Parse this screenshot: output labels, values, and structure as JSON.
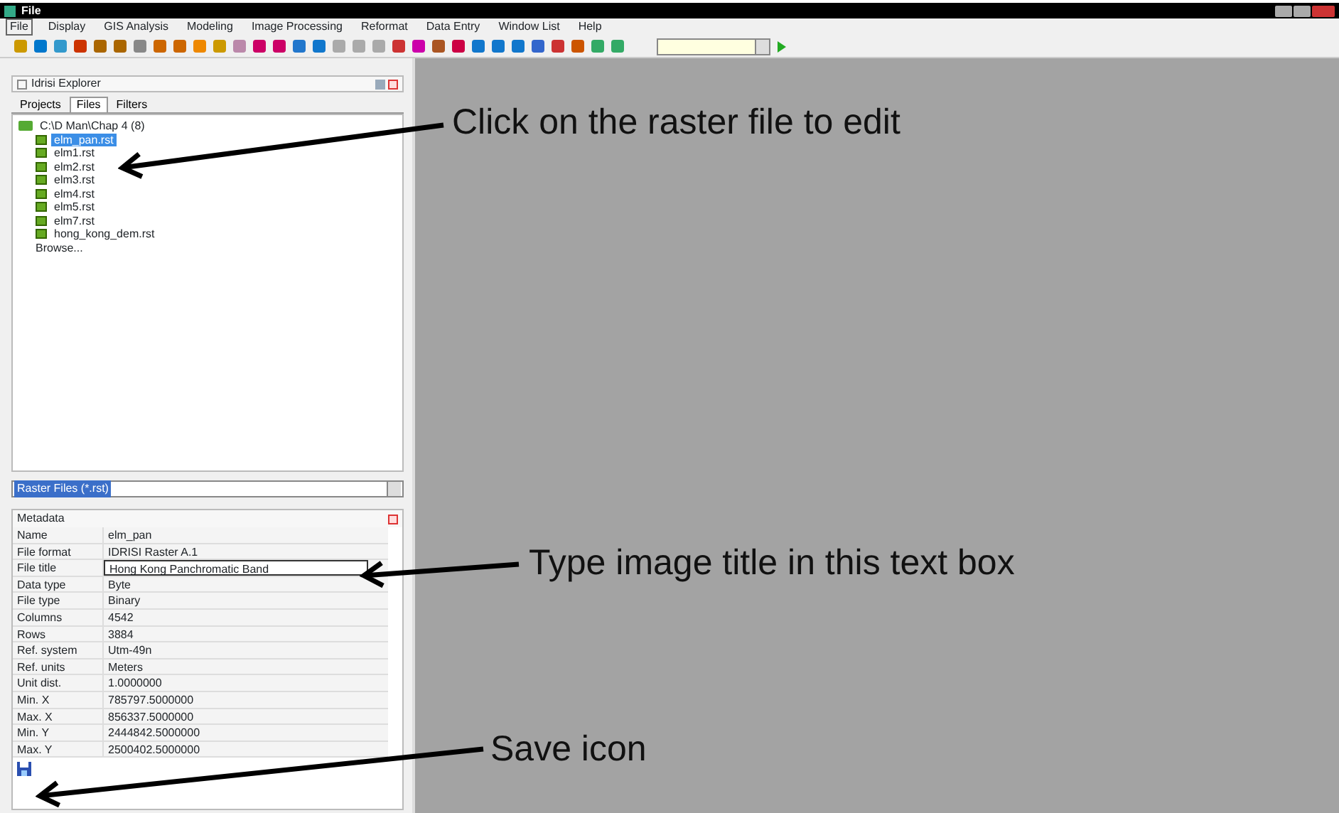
{
  "window": {
    "title": "File"
  },
  "menu": [
    {
      "label": "File",
      "selected": true
    },
    {
      "label": "Display",
      "selected": false
    },
    {
      "label": "GIS Analysis",
      "selected": false
    },
    {
      "label": "Modeling",
      "selected": false
    },
    {
      "label": "Image Processing",
      "selected": false
    },
    {
      "label": "Reformat",
      "selected": false
    },
    {
      "label": "Data Entry",
      "selected": false
    },
    {
      "label": "Window List",
      "selected": false
    },
    {
      "label": "Help",
      "selected": false
    }
  ],
  "explorer": {
    "title": "Idrisi Explorer",
    "tabs": [
      {
        "label": "Projects",
        "selected": false
      },
      {
        "label": "Files",
        "selected": true
      },
      {
        "label": "Filters",
        "selected": false
      }
    ],
    "tree": {
      "label": "C:\\D Man\\Chap 4 (8)",
      "children": [
        {
          "label": "elm_pan.rst",
          "selected": true
        },
        {
          "label": "elm1.rst",
          "selected": false
        },
        {
          "label": "elm2.rst",
          "selected": false
        },
        {
          "label": "elm3.rst",
          "selected": false
        },
        {
          "label": "elm4.rst",
          "selected": false
        },
        {
          "label": "elm5.rst",
          "selected": false
        },
        {
          "label": "elm7.rst",
          "selected": false
        },
        {
          "label": "hong_kong_dem.rst",
          "selected": false
        }
      ]
    },
    "browse": "Browse...",
    "filter": "Raster Files (*.rst)"
  },
  "metadata": {
    "title": "Metadata",
    "rows": [
      {
        "label": "Name",
        "value": "elm_pan",
        "editing": false
      },
      {
        "label": "File format",
        "value": "IDRISI Raster A.1",
        "editing": false
      },
      {
        "label": "File title",
        "value": "Hong Kong Panchromatic Band",
        "editing": true
      },
      {
        "label": "Data type",
        "value": "Byte",
        "editing": false
      },
      {
        "label": "File type",
        "value": "Binary",
        "editing": false
      },
      {
        "label": "Columns",
        "value": "4542",
        "editing": false
      },
      {
        "label": "Rows",
        "value": "3884",
        "editing": false
      },
      {
        "label": "Ref. system",
        "value": "Utm-49n",
        "editing": false
      },
      {
        "label": "Ref. units",
        "value": "Meters",
        "editing": false
      },
      {
        "label": "Unit dist.",
        "value": "1.0000000",
        "editing": false
      },
      {
        "label": "Min. X",
        "value": "785797.5000000",
        "editing": false
      },
      {
        "label": "Max. X",
        "value": "856337.5000000",
        "editing": false
      },
      {
        "label": "Min. Y",
        "value": "2444842.5000000",
        "editing": false
      },
      {
        "label": "Max. Y",
        "value": "2500402.5000000",
        "editing": false
      }
    ]
  },
  "annotations": [
    {
      "text": "Click on the raster file to edit"
    },
    {
      "text": "Type image title in this text box"
    },
    {
      "text": "Save icon"
    }
  ]
}
